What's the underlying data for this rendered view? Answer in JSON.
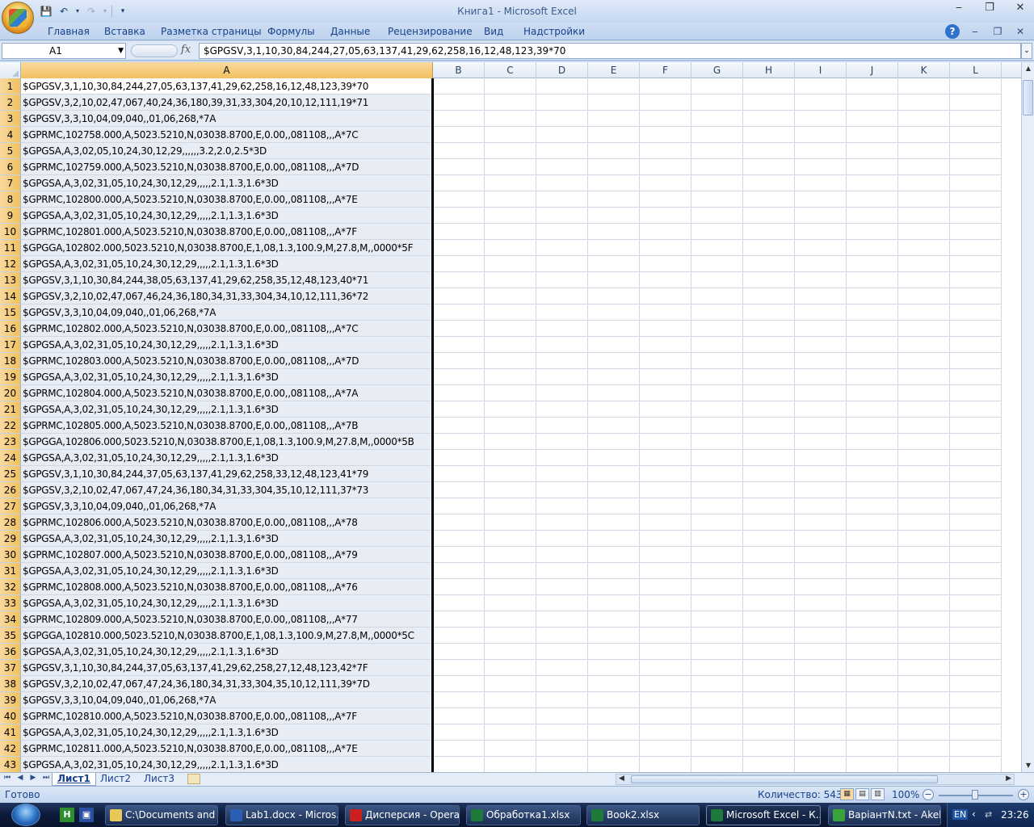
{
  "window": {
    "title": "Книга1 - Microsoft Excel",
    "minimize": "‒",
    "maximize": "❐",
    "close": "✕"
  },
  "ribbon": {
    "tabs": [
      "Главная",
      "Вставка",
      "Разметка страницы",
      "Формулы",
      "Данные",
      "Рецензирование",
      "Вид",
      "Надстройки"
    ]
  },
  "formula_bar": {
    "name_box": "A1",
    "fx": "fx",
    "content": "$GPGSV,3,1,10,30,84,244,27,05,63,137,41,29,62,258,16,12,48,123,39*70"
  },
  "columns": [
    "A",
    "B",
    "C",
    "D",
    "E",
    "F",
    "G",
    "H",
    "I",
    "J",
    "K",
    "L"
  ],
  "rows": [
    "$GPGSV,3,1,10,30,84,244,27,05,63,137,41,29,62,258,16,12,48,123,39*70",
    "$GPGSV,3,2,10,02,47,067,40,24,36,180,39,31,33,304,20,10,12,111,19*71",
    "$GPGSV,3,3,10,04,09,040,,01,06,268,*7A",
    "$GPRMC,102758.000,A,5023.5210,N,03038.8700,E,0.00,,081108,,,A*7C",
    "$GPGSA,A,3,02,05,10,24,30,12,29,,,,,,3.2,2.0,2.5*3D",
    "$GPRMC,102759.000,A,5023.5210,N,03038.8700,E,0.00,,081108,,,A*7D",
    "$GPGSA,A,3,02,31,05,10,24,30,12,29,,,,,2.1,1.3,1.6*3D",
    "$GPRMC,102800.000,A,5023.5210,N,03038.8700,E,0.00,,081108,,,A*7E",
    "$GPGSA,A,3,02,31,05,10,24,30,12,29,,,,,2.1,1.3,1.6*3D",
    "$GPRMC,102801.000,A,5023.5210,N,03038.8700,E,0.00,,081108,,,A*7F",
    "$GPGGA,102802.000,5023.5210,N,03038.8700,E,1,08,1.3,100.9,M,27.8,M,,0000*5F",
    "$GPGSA,A,3,02,31,05,10,24,30,12,29,,,,,2.1,1.3,1.6*3D",
    "$GPGSV,3,1,10,30,84,244,38,05,63,137,41,29,62,258,35,12,48,123,40*71",
    "$GPGSV,3,2,10,02,47,067,46,24,36,180,34,31,33,304,34,10,12,111,36*72",
    "$GPGSV,3,3,10,04,09,040,,01,06,268,*7A",
    "$GPRMC,102802.000,A,5023.5210,N,03038.8700,E,0.00,,081108,,,A*7C",
    "$GPGSA,A,3,02,31,05,10,24,30,12,29,,,,,2.1,1.3,1.6*3D",
    "$GPRMC,102803.000,A,5023.5210,N,03038.8700,E,0.00,,081108,,,A*7D",
    "$GPGSA,A,3,02,31,05,10,24,30,12,29,,,,,2.1,1.3,1.6*3D",
    "$GPRMC,102804.000,A,5023.5210,N,03038.8700,E,0.00,,081108,,,A*7A",
    "$GPGSA,A,3,02,31,05,10,24,30,12,29,,,,,2.1,1.3,1.6*3D",
    "$GPRMC,102805.000,A,5023.5210,N,03038.8700,E,0.00,,081108,,,A*7B",
    "$GPGGA,102806.000,5023.5210,N,03038.8700,E,1,08,1.3,100.9,M,27.8,M,,0000*5B",
    "$GPGSA,A,3,02,31,05,10,24,30,12,29,,,,,2.1,1.3,1.6*3D",
    "$GPGSV,3,1,10,30,84,244,37,05,63,137,41,29,62,258,33,12,48,123,41*79",
    "$GPGSV,3,2,10,02,47,067,47,24,36,180,34,31,33,304,35,10,12,111,37*73",
    "$GPGSV,3,3,10,04,09,040,,01,06,268,*7A",
    "$GPRMC,102806.000,A,5023.5210,N,03038.8700,E,0.00,,081108,,,A*78",
    "$GPGSA,A,3,02,31,05,10,24,30,12,29,,,,,2.1,1.3,1.6*3D",
    "$GPRMC,102807.000,A,5023.5210,N,03038.8700,E,0.00,,081108,,,A*79",
    "$GPGSA,A,3,02,31,05,10,24,30,12,29,,,,,2.1,1.3,1.6*3D",
    "$GPRMC,102808.000,A,5023.5210,N,03038.8700,E,0.00,,081108,,,A*76",
    "$GPGSA,A,3,02,31,05,10,24,30,12,29,,,,,2.1,1.3,1.6*3D",
    "$GPRMC,102809.000,A,5023.5210,N,03038.8700,E,0.00,,081108,,,A*77",
    "$GPGGA,102810.000,5023.5210,N,03038.8700,E,1,08,1.3,100.9,M,27.8,M,,0000*5C",
    "$GPGSA,A,3,02,31,05,10,24,30,12,29,,,,,2.1,1.3,1.6*3D",
    "$GPGSV,3,1,10,30,84,244,37,05,63,137,41,29,62,258,27,12,48,123,42*7F",
    "$GPGSV,3,2,10,02,47,067,47,24,36,180,34,31,33,304,35,10,12,111,39*7D",
    "$GPGSV,3,3,10,04,09,040,,01,06,268,*7A",
    "$GPRMC,102810.000,A,5023.5210,N,03038.8700,E,0.00,,081108,,,A*7F",
    "$GPGSA,A,3,02,31,05,10,24,30,12,29,,,,,2.1,1.3,1.6*3D",
    "$GPRMC,102811.000,A,5023.5210,N,03038.8700,E,0.00,,081108,,,A*7E",
    "$GPGSA,A,3,02,31,05,10,24,30,12,29,,,,,2.1,1.3,1.6*3D"
  ],
  "sheets": [
    "Лист1",
    "Лист2",
    "Лист3"
  ],
  "status": {
    "ready": "Готово",
    "count": "Количество: 543",
    "zoom": "100%"
  },
  "taskbar": {
    "tasks": [
      {
        "label": "C:\\Documents and ...",
        "icon": "folder-icon",
        "color": "#e8c85a"
      },
      {
        "label": "Lab1.docx - Micros...",
        "icon": "word-icon",
        "color": "#2b5fb4"
      },
      {
        "label": "Дисперсия - Opera",
        "icon": "opera-icon",
        "color": "#cc1f1f"
      },
      {
        "label": "Обработка1.xlsx",
        "icon": "excel-icon",
        "color": "#1d7a3a"
      },
      {
        "label": "Book2.xlsx",
        "icon": "excel-icon",
        "color": "#1d7a3a"
      },
      {
        "label": "Microsoft Excel - К...",
        "icon": "excel-icon",
        "color": "#1d7a3a"
      },
      {
        "label": "ВаріантN.txt - Akel...",
        "icon": "notepad-icon",
        "color": "#3aa33a"
      }
    ],
    "lang": "EN",
    "clock": "23:26"
  },
  "colors": {
    "selected_header": "#f1c15f",
    "column_a_fill": "#e8ecf5"
  }
}
